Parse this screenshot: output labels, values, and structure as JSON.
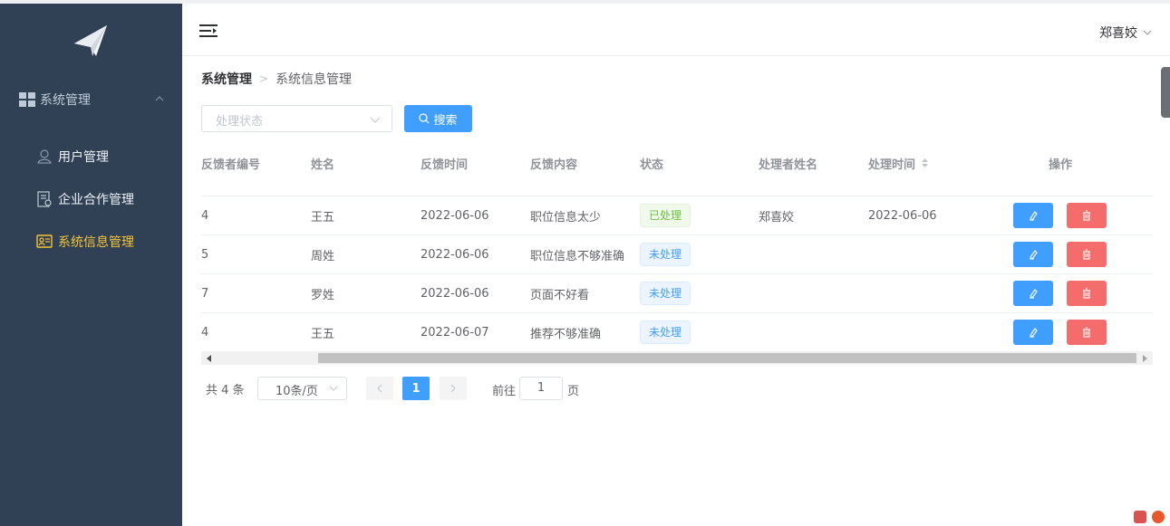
{
  "sidebar": {
    "group_label": "系统管理",
    "items": [
      {
        "label": "用户管理",
        "icon": "user-icon",
        "active": false
      },
      {
        "label": "企业合作管理",
        "icon": "document-icon",
        "active": false
      },
      {
        "label": "系统信息管理",
        "icon": "id-card-icon",
        "active": true
      }
    ]
  },
  "header": {
    "user_name": "郑喜姣"
  },
  "breadcrumb": {
    "root": "系统管理",
    "current": "系统信息管理"
  },
  "filter": {
    "status_placeholder": "处理状态",
    "search_label": "搜索"
  },
  "table": {
    "columns": [
      "反馈者编号",
      "姓名",
      "反馈时间",
      "反馈内容",
      "状态",
      "处理者姓名",
      "处理时间",
      "操作"
    ],
    "rows": [
      {
        "id": "4",
        "name": "王五",
        "time": "2022-06-06",
        "content": "职位信息太少",
        "status": "已处理",
        "status_type": "done",
        "handler": "郑喜姣",
        "handled_time": "2022-06-06"
      },
      {
        "id": "5",
        "name": "周姓",
        "time": "2022-06-06",
        "content": "职位信息不够准确",
        "status": "未处理",
        "status_type": "todo",
        "handler": "",
        "handled_time": ""
      },
      {
        "id": "7",
        "name": "罗姓",
        "time": "2022-06-06",
        "content": "页面不好看",
        "status": "未处理",
        "status_type": "todo",
        "handler": "",
        "handled_time": ""
      },
      {
        "id": "4",
        "name": "王五",
        "time": "2022-06-07",
        "content": "推荐不够准确",
        "status": "未处理",
        "status_type": "todo",
        "handler": "",
        "handled_time": ""
      }
    ]
  },
  "pagination": {
    "total_text": "共 4 条",
    "page_size": "10条/页",
    "current_page": "1",
    "goto_label": "前往",
    "goto_value": "1",
    "goto_suffix": "页"
  },
  "colors": {
    "sidebar_bg": "#304156",
    "primary": "#409eff",
    "danger": "#f56c6c",
    "active_menu": "#f5c437"
  }
}
